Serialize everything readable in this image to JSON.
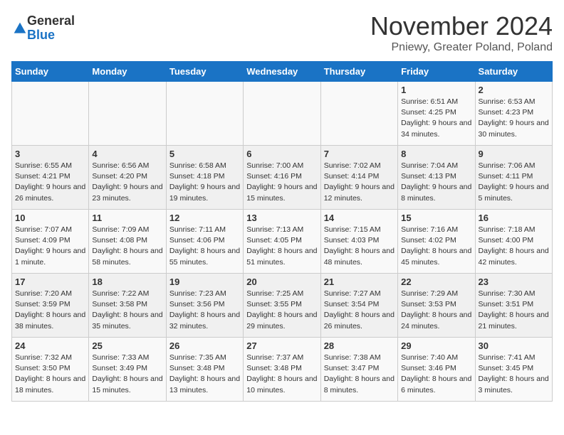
{
  "logo": {
    "general": "General",
    "blue": "Blue"
  },
  "title": "November 2024",
  "location": "Pniewy, Greater Poland, Poland",
  "days_of_week": [
    "Sunday",
    "Monday",
    "Tuesday",
    "Wednesday",
    "Thursday",
    "Friday",
    "Saturday"
  ],
  "weeks": [
    [
      {
        "day": "",
        "info": ""
      },
      {
        "day": "",
        "info": ""
      },
      {
        "day": "",
        "info": ""
      },
      {
        "day": "",
        "info": ""
      },
      {
        "day": "",
        "info": ""
      },
      {
        "day": "1",
        "info": "Sunrise: 6:51 AM\nSunset: 4:25 PM\nDaylight: 9 hours\nand 34 minutes."
      },
      {
        "day": "2",
        "info": "Sunrise: 6:53 AM\nSunset: 4:23 PM\nDaylight: 9 hours\nand 30 minutes."
      }
    ],
    [
      {
        "day": "3",
        "info": "Sunrise: 6:55 AM\nSunset: 4:21 PM\nDaylight: 9 hours\nand 26 minutes."
      },
      {
        "day": "4",
        "info": "Sunrise: 6:56 AM\nSunset: 4:20 PM\nDaylight: 9 hours\nand 23 minutes."
      },
      {
        "day": "5",
        "info": "Sunrise: 6:58 AM\nSunset: 4:18 PM\nDaylight: 9 hours\nand 19 minutes."
      },
      {
        "day": "6",
        "info": "Sunrise: 7:00 AM\nSunset: 4:16 PM\nDaylight: 9 hours\nand 15 minutes."
      },
      {
        "day": "7",
        "info": "Sunrise: 7:02 AM\nSunset: 4:14 PM\nDaylight: 9 hours\nand 12 minutes."
      },
      {
        "day": "8",
        "info": "Sunrise: 7:04 AM\nSunset: 4:13 PM\nDaylight: 9 hours\nand 8 minutes."
      },
      {
        "day": "9",
        "info": "Sunrise: 7:06 AM\nSunset: 4:11 PM\nDaylight: 9 hours\nand 5 minutes."
      }
    ],
    [
      {
        "day": "10",
        "info": "Sunrise: 7:07 AM\nSunset: 4:09 PM\nDaylight: 9 hours\nand 1 minute."
      },
      {
        "day": "11",
        "info": "Sunrise: 7:09 AM\nSunset: 4:08 PM\nDaylight: 8 hours\nand 58 minutes."
      },
      {
        "day": "12",
        "info": "Sunrise: 7:11 AM\nSunset: 4:06 PM\nDaylight: 8 hours\nand 55 minutes."
      },
      {
        "day": "13",
        "info": "Sunrise: 7:13 AM\nSunset: 4:05 PM\nDaylight: 8 hours\nand 51 minutes."
      },
      {
        "day": "14",
        "info": "Sunrise: 7:15 AM\nSunset: 4:03 PM\nDaylight: 8 hours\nand 48 minutes."
      },
      {
        "day": "15",
        "info": "Sunrise: 7:16 AM\nSunset: 4:02 PM\nDaylight: 8 hours\nand 45 minutes."
      },
      {
        "day": "16",
        "info": "Sunrise: 7:18 AM\nSunset: 4:00 PM\nDaylight: 8 hours\nand 42 minutes."
      }
    ],
    [
      {
        "day": "17",
        "info": "Sunrise: 7:20 AM\nSunset: 3:59 PM\nDaylight: 8 hours\nand 38 minutes."
      },
      {
        "day": "18",
        "info": "Sunrise: 7:22 AM\nSunset: 3:58 PM\nDaylight: 8 hours\nand 35 minutes."
      },
      {
        "day": "19",
        "info": "Sunrise: 7:23 AM\nSunset: 3:56 PM\nDaylight: 8 hours\nand 32 minutes."
      },
      {
        "day": "20",
        "info": "Sunrise: 7:25 AM\nSunset: 3:55 PM\nDaylight: 8 hours\nand 29 minutes."
      },
      {
        "day": "21",
        "info": "Sunrise: 7:27 AM\nSunset: 3:54 PM\nDaylight: 8 hours\nand 26 minutes."
      },
      {
        "day": "22",
        "info": "Sunrise: 7:29 AM\nSunset: 3:53 PM\nDaylight: 8 hours\nand 24 minutes."
      },
      {
        "day": "23",
        "info": "Sunrise: 7:30 AM\nSunset: 3:51 PM\nDaylight: 8 hours\nand 21 minutes."
      }
    ],
    [
      {
        "day": "24",
        "info": "Sunrise: 7:32 AM\nSunset: 3:50 PM\nDaylight: 8 hours\nand 18 minutes."
      },
      {
        "day": "25",
        "info": "Sunrise: 7:33 AM\nSunset: 3:49 PM\nDaylight: 8 hours\nand 15 minutes."
      },
      {
        "day": "26",
        "info": "Sunrise: 7:35 AM\nSunset: 3:48 PM\nDaylight: 8 hours\nand 13 minutes."
      },
      {
        "day": "27",
        "info": "Sunrise: 7:37 AM\nSunset: 3:48 PM\nDaylight: 8 hours\nand 10 minutes."
      },
      {
        "day": "28",
        "info": "Sunrise: 7:38 AM\nSunset: 3:47 PM\nDaylight: 8 hours\nand 8 minutes."
      },
      {
        "day": "29",
        "info": "Sunrise: 7:40 AM\nSunset: 3:46 PM\nDaylight: 8 hours\nand 6 minutes."
      },
      {
        "day": "30",
        "info": "Sunrise: 7:41 AM\nSunset: 3:45 PM\nDaylight: 8 hours\nand 3 minutes."
      }
    ]
  ]
}
